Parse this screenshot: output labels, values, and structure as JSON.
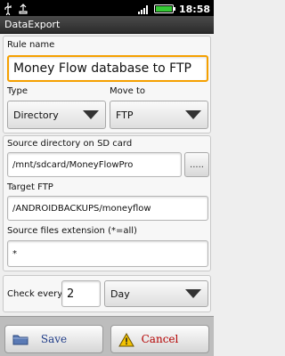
{
  "statusbar": {
    "time": "18:58",
    "icons": [
      "usb-icon",
      "usb-debug-icon",
      "signal-icon",
      "battery-icon"
    ]
  },
  "titlebar": {
    "title": "DataExport"
  },
  "rule": {
    "label": "Rule name",
    "value": "Money Flow database to FTP"
  },
  "type": {
    "label": "Type",
    "value": "Directory"
  },
  "move_to": {
    "label": "Move to",
    "value": "FTP"
  },
  "source_dir": {
    "label": "Source directory on SD card",
    "value": "/mnt/sdcard/MoneyFlowPro",
    "browse_label": "....."
  },
  "target_ftp": {
    "label": "Target FTP",
    "value": "/ANDROIDBACKUPS/moneyflow"
  },
  "source_ext": {
    "label": "Source files extension (*=all)",
    "value": "*"
  },
  "check": {
    "label": "Check every",
    "value": "2",
    "unit": "Day"
  },
  "buttons": {
    "save": "Save",
    "cancel": "Cancel"
  },
  "colors": {
    "focus": "#f5a000",
    "cancel_text": "#b40000",
    "save_text": "#1f3c88",
    "statusbar_green": "#35c935"
  }
}
